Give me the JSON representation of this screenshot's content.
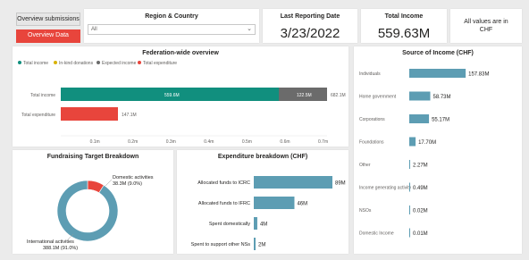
{
  "nav": {
    "overview_submissions": "Overview submissions",
    "overview_data": "Overview Data"
  },
  "filter": {
    "title": "Region & Country",
    "selected": "All"
  },
  "kpis": {
    "last_reporting_title": "Last Reporting Date",
    "last_reporting_value": "3/23/2022",
    "total_income_title": "Total Income",
    "total_income_value": "559.63M",
    "note": "All values are in CHF"
  },
  "federation": {
    "title": "Federation-wide overview",
    "legend": [
      "Total income",
      "In-kind donations",
      "Expected income",
      "Total expenditure"
    ],
    "legend_colors": [
      "#118f7e",
      "#d9b300",
      "#6b6b6b",
      "#e8453c"
    ],
    "rows": [
      "Total income",
      "Total expenditure"
    ],
    "x_ticks": [
      "0.1m",
      "0.2m",
      "0.3m",
      "0.4m",
      "0.5m",
      "0.6m",
      "0.7m"
    ],
    "bar_labels": [
      "559.6M",
      "122.5M",
      "682.1M",
      "147.1M"
    ]
  },
  "source": {
    "title": "Source of Income (CHF)",
    "bar_color": "#5d9db3"
  },
  "fundraising": {
    "title": "Fundraising Target Breakdown",
    "label_domestic": "Domestic activities",
    "label_domestic_value": "38.3M (9.0%)",
    "label_international": "International activities",
    "label_international_value": "388.1M (91.0%)",
    "colors": [
      "#e8453c",
      "#5d9db3"
    ]
  },
  "expenditure": {
    "title": "Expenditure breakdown (CHF)",
    "bar_color": "#5d9db3"
  },
  "chart_data": [
    {
      "type": "bar",
      "title": "Federation-wide overview",
      "categories": [
        "Total income",
        "Total expenditure"
      ],
      "series": [
        {
          "name": "Total income",
          "values": [
            559.6,
            0
          ]
        },
        {
          "name": "Expected income",
          "values": [
            122.5,
            0
          ]
        },
        {
          "name": "Total expenditure",
          "values": [
            0,
            147.1
          ]
        }
      ],
      "totals": [
        "682.1M",
        "147.1M"
      ],
      "xlim": [
        0,
        700
      ],
      "orientation": "horizontal",
      "stacked": true,
      "legend": "top-left"
    },
    {
      "type": "bar",
      "title": "Source of Income (CHF)",
      "categories": [
        "Individuals",
        "Home government",
        "Corporations",
        "Foundations",
        "Other",
        "Income generating activity",
        "NSOs",
        "Domestic Income"
      ],
      "values": [
        157.83,
        58.73,
        55.17,
        17.7,
        2.27,
        0.49,
        0.02,
        0.01
      ],
      "labels": [
        "157.83M",
        "58.73M",
        "55.17M",
        "17.70M",
        "2.27M",
        "0.49M",
        "0.02M",
        "0.01M"
      ],
      "orientation": "horizontal"
    },
    {
      "type": "pie",
      "title": "Fundraising Target Breakdown",
      "categories": [
        "Domestic activities",
        "International activities"
      ],
      "values": [
        38.3,
        388.1
      ],
      "percent": [
        9.0,
        91.0
      ],
      "donut": true
    },
    {
      "type": "bar",
      "title": "Expenditure breakdown (CHF)",
      "categories": [
        "Allocated funds to ICRC",
        "Allocated funds to IFRC",
        "Spent domestically",
        "Spent to support other NSs"
      ],
      "values": [
        89,
        46,
        4,
        2
      ],
      "labels": [
        "89M",
        "46M",
        "4M",
        "2M"
      ],
      "orientation": "horizontal"
    }
  ]
}
